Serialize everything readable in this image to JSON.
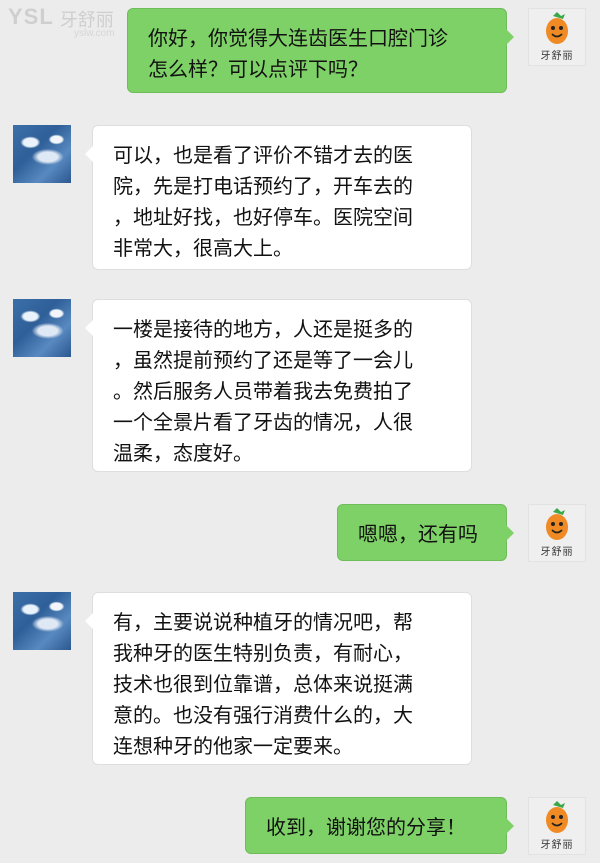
{
  "watermark": {
    "brand_latin": "YSL",
    "brand_cn": "牙舒丽",
    "url": "yslw.com"
  },
  "avatars": {
    "me_brand": "牙舒丽",
    "other_icon": "seagull-photo-avatar",
    "me_icon": "carrot-mascot-avatar"
  },
  "colors": {
    "outgoing_bubble": "#7ed167",
    "incoming_bubble": "#ffffff",
    "background": "#ececec"
  },
  "messages": [
    {
      "from": "me",
      "text": "你好，你觉得大连齿医生口腔门诊\n怎么样？可以点评下吗？"
    },
    {
      "from": "other",
      "text": "可以，也是看了评价不错才去的医\n院，先是打电话预约了，开车去的\n，地址好找，也好停车。医院空间\n非常大，很高大上。"
    },
    {
      "from": "other",
      "text": "一楼是接待的地方，人还是挺多的\n，虽然提前预约了还是等了一会儿\n。然后服务人员带着我去免费拍了\n一个全景片看了牙齿的情况，人很\n温柔，态度好。"
    },
    {
      "from": "me",
      "text": "嗯嗯，还有吗"
    },
    {
      "from": "other",
      "text": "有，主要说说种植牙的情况吧，帮\n我种牙的医生特别负责，有耐心，\n技术也很到位靠谱，总体来说挺满\n意的。也没有强行消费什么的，大\n连想种牙的他家一定要来。"
    },
    {
      "from": "me",
      "text": "收到，谢谢您的分享！"
    }
  ]
}
